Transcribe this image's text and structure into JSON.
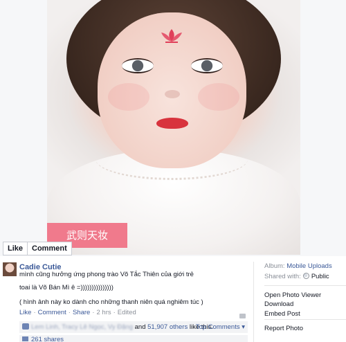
{
  "photo": {
    "caption_badge": "武则天妆"
  },
  "photo_actions": {
    "like_label": "Like",
    "comment_label": "Comment"
  },
  "post": {
    "author": "Cadie Cutie",
    "line1": "mình cũng hưởng ứng phong trào Võ Tắc Thiên của giới trẻ",
    "line2": "toai là Võ Bán Mì ê =)))))))))))))))",
    "line3": "( hình ảnh này ko dành cho những thanh niên quá nghiêm túc )",
    "actions": {
      "like": "Like",
      "comment": "Comment",
      "share": "Share",
      "time": "2 hrs",
      "edited": "Edited"
    },
    "likes": {
      "names_blurred": "Lem Linh, Tracy Lê Ngọc, Vy Đặng",
      "and_text": "and",
      "others_count": "51,907 others",
      "like_this": "like this.",
      "top_comments": "Top Comments ▾"
    },
    "shares": "261 shares"
  },
  "sidebar": {
    "album_label": "Album:",
    "album_value": "Mobile Uploads",
    "shared_label": "Shared with:",
    "shared_value": "Public",
    "open_viewer": "Open Photo Viewer",
    "download": "Download",
    "embed": "Embed Post",
    "report": "Report Photo"
  },
  "colors": {
    "link": "#3b5998",
    "badge": "#f07a8c",
    "muted": "#8a8f98"
  }
}
